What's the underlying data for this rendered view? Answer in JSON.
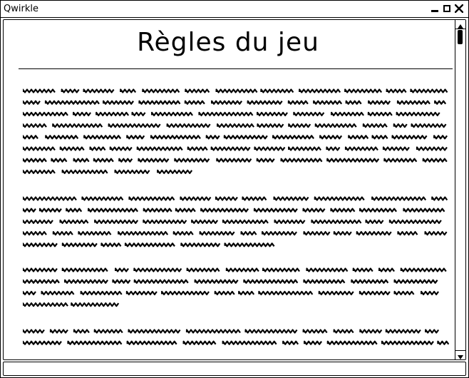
{
  "window": {
    "title": "Qwirkle",
    "controls": [
      "minimize-icon",
      "maximize-icon",
      "close-icon"
    ]
  },
  "page": {
    "heading": "Règles du jeu"
  },
  "body": {
    "paragraph_count": 4
  }
}
